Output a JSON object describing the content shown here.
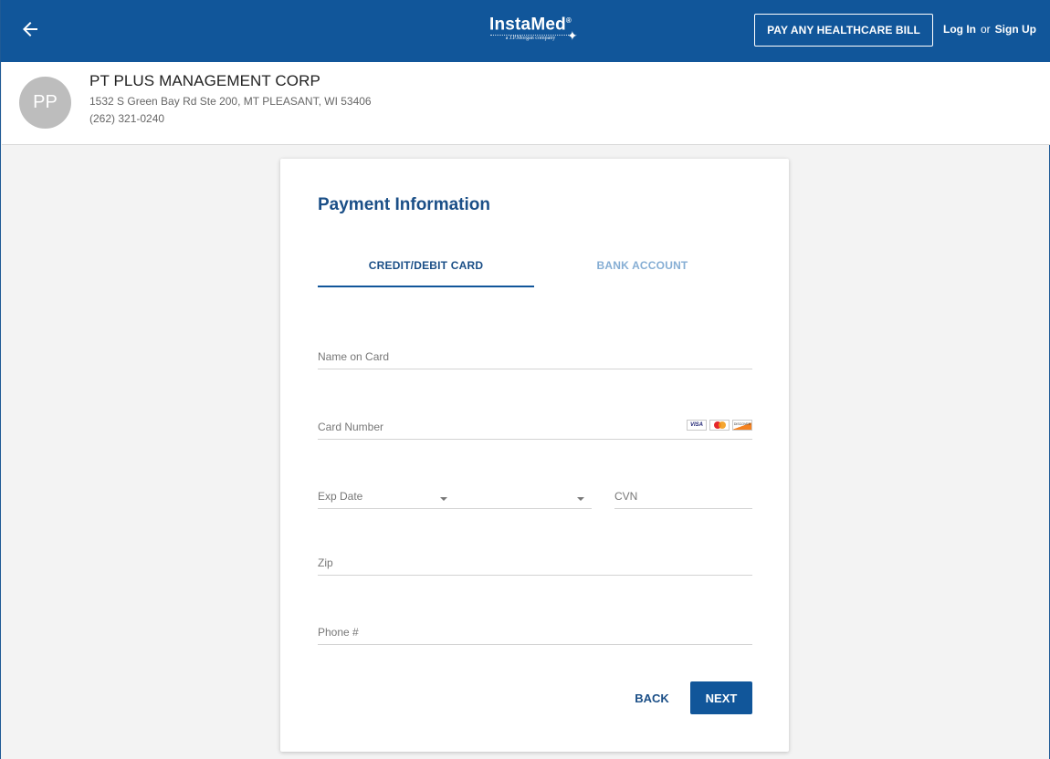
{
  "header": {
    "brand": {
      "name": "InstaMed",
      "trademark": "®",
      "subtitle": "a J.P.Morgan company"
    },
    "pay_button": "PAY ANY HEALTHCARE BILL",
    "login": "Log In",
    "or": "or",
    "signup": "Sign Up",
    "icons": {
      "back": "arrow-left-icon"
    },
    "colors": {
      "bar": "#11569a",
      "accent": "#1b4f87"
    }
  },
  "provider": {
    "initials": "PP",
    "name": "PT PLUS MANAGEMENT CORP",
    "address": "1532 S Green Bay Rd Ste 200, MT PLEASANT, WI 53406",
    "phone": "(262) 321-0240"
  },
  "payment": {
    "title": "Payment Information",
    "tabs": [
      {
        "label": "CREDIT/DEBIT CARD",
        "active": true
      },
      {
        "label": "BANK ACCOUNT",
        "active": false
      }
    ],
    "fields": {
      "name_on_card": {
        "label": "Name on Card",
        "value": ""
      },
      "card_number": {
        "label": "Card Number",
        "value": ""
      },
      "exp_date": {
        "label": "Exp Date",
        "month": "",
        "year": ""
      },
      "cvn": {
        "label": "CVN",
        "value": ""
      },
      "zip": {
        "label": "Zip",
        "value": ""
      },
      "phone": {
        "label": "Phone #",
        "value": ""
      }
    },
    "card_logos": {
      "visa": "VISA",
      "mastercard": "mastercard-logo",
      "discover": "DISCOVER"
    },
    "buttons": {
      "back": "BACK",
      "next": "NEXT"
    }
  }
}
